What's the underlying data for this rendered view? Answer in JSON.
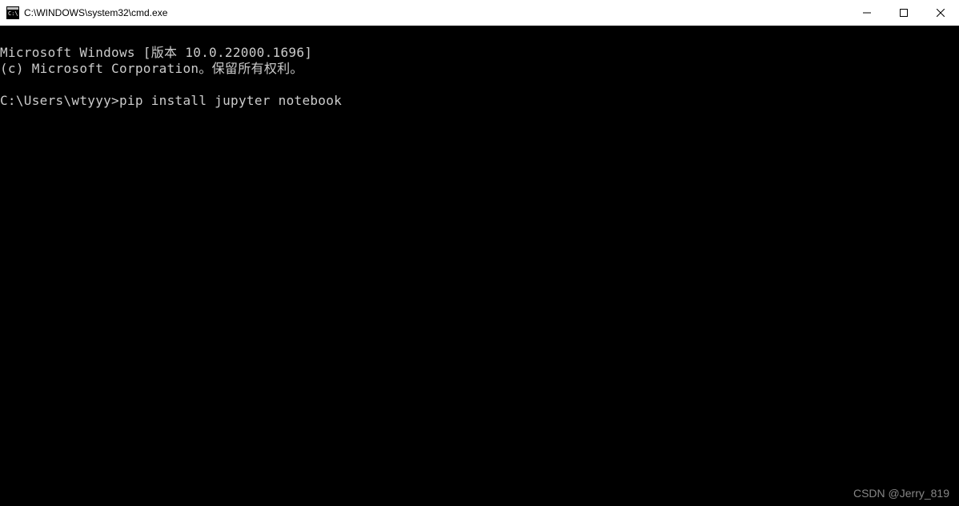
{
  "window": {
    "title": "C:\\WINDOWS\\system32\\cmd.exe"
  },
  "terminal": {
    "line1": "Microsoft Windows [版本 10.0.22000.1696]",
    "line2": "(c) Microsoft Corporation。保留所有权利。",
    "blank1": "",
    "prompt_line": "C:\\Users\\wtyyy>pip install jupyter notebook"
  },
  "watermark": "CSDN @Jerry_819"
}
